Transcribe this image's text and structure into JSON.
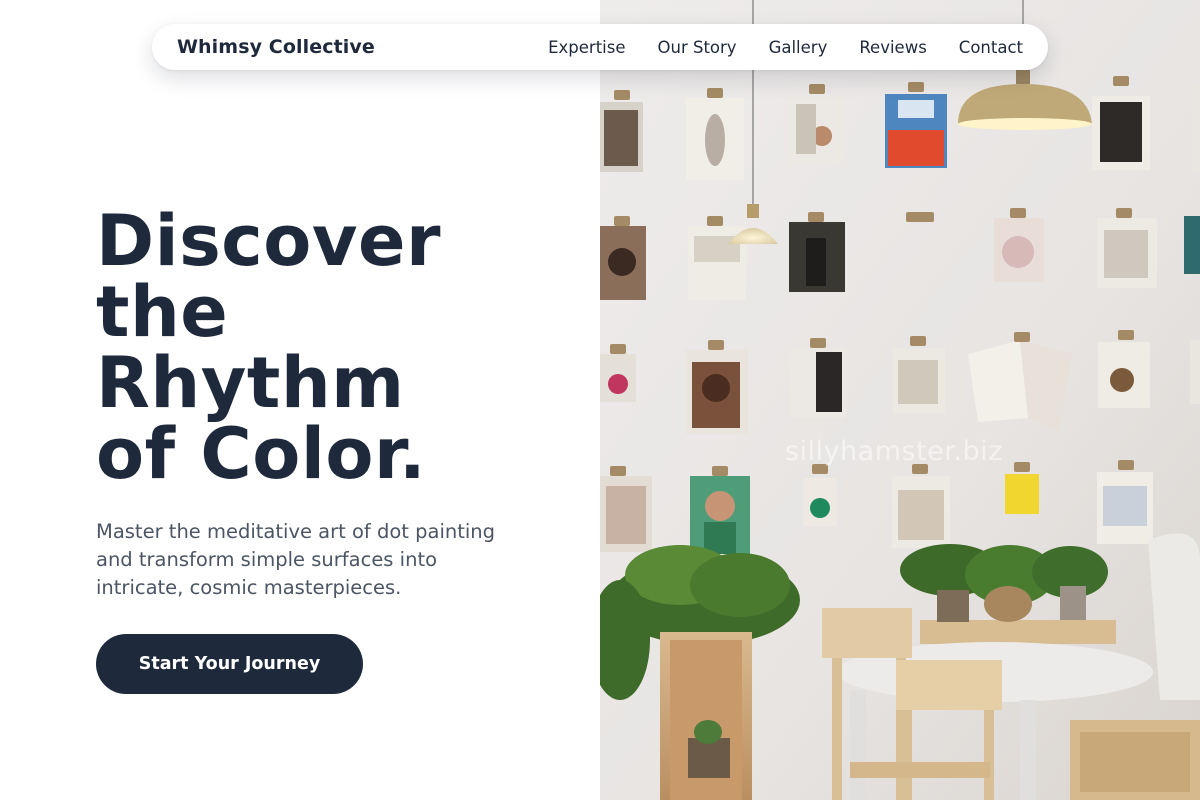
{
  "nav": {
    "brand": "Whimsy Collective",
    "links": [
      "Expertise",
      "Our Story",
      "Gallery",
      "Reviews",
      "Contact"
    ]
  },
  "hero": {
    "headline_lines": [
      "Discover",
      "the",
      "Rhythm",
      "of Color."
    ],
    "subtitle": "Master the meditative art of dot painting and transform simple surfaces into intricate, cosmic masterpieces.",
    "cta_label": "Start Your Journey"
  },
  "photo": {
    "watermark": "sillyhamster.biz",
    "alt": "Café interior with a wall of clipboards holding magazines, hanging lamps, plants, and a round white table with wooden chairs"
  },
  "colors": {
    "primary_navy": "#1e293b",
    "body_text": "#4b5563",
    "background": "#ffffff"
  }
}
